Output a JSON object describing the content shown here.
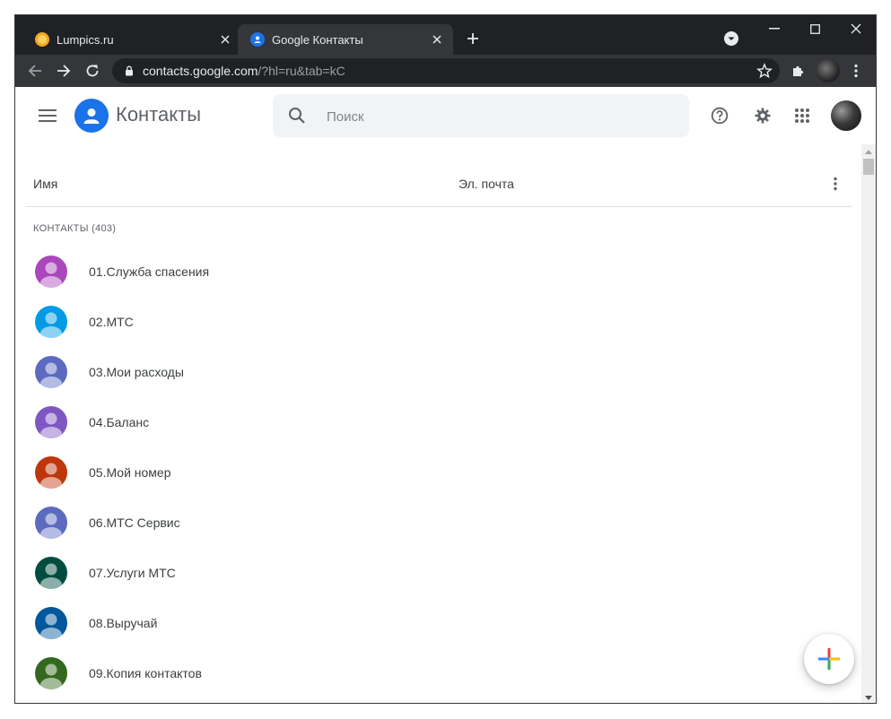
{
  "browser": {
    "tabs": [
      {
        "title": "Lumpics.ru",
        "active": false,
        "favicon_color": "#f5a623"
      },
      {
        "title": "Google Контакты",
        "active": true,
        "favicon_color": "#1a73e8"
      }
    ],
    "address": {
      "domain": "contacts.google.com",
      "path": "/?hl=ru&tab=kC"
    }
  },
  "app": {
    "title": "Контакты",
    "search_placeholder": "Поиск"
  },
  "table": {
    "columns": [
      "Имя",
      "Эл. почта"
    ],
    "section_label": "КОНТАКТЫ (403)",
    "contacts": [
      {
        "name": "01.Служба спасения",
        "color": "#ab47bc"
      },
      {
        "name": "02.МТС",
        "color": "#039be5"
      },
      {
        "name": "03.Мои расходы",
        "color": "#5c6bc0"
      },
      {
        "name": "04.Баланс",
        "color": "#7e57c2"
      },
      {
        "name": "05.Мой номер",
        "color": "#bf360c"
      },
      {
        "name": "06.МТС Сервис",
        "color": "#5c6bc0"
      },
      {
        "name": "07.Услуги МТС",
        "color": "#004d40"
      },
      {
        "name": "08.Выручай",
        "color": "#01579b"
      },
      {
        "name": "09.Копия контактов",
        "color": "#33691e"
      }
    ]
  },
  "colors": {
    "accent": "#1a73e8",
    "chrome_dark": "#202124",
    "chrome_toolbar": "#35363a"
  }
}
